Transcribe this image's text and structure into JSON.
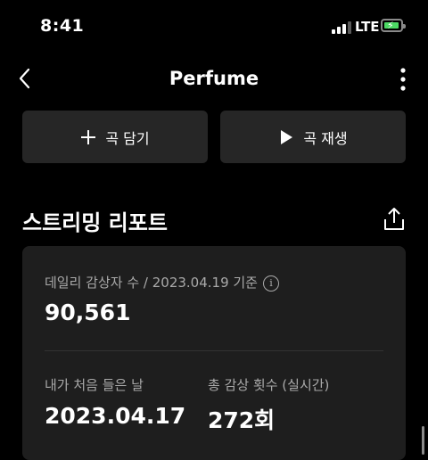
{
  "status_bar": {
    "time": "8:41",
    "network": "LTE",
    "battery_level": 0.7,
    "charging": true
  },
  "header": {
    "title": "Perfume",
    "back_icon": "chevron-left-icon",
    "more_icon": "more-vertical-icon"
  },
  "actions": {
    "add_label": "곡 담기",
    "play_label": "곡 재생"
  },
  "section": {
    "title": "스트리밍 리포트",
    "share_icon": "share-icon"
  },
  "report": {
    "daily_listeners_label": "데일리 감상자 수 / 2023.04.19 기준",
    "daily_listeners_value": "90,561",
    "first_listen_label": "내가 처음 들은 날",
    "first_listen_value": "2023.04.17",
    "total_plays_label": "총 감상 횟수 (실시간)",
    "total_plays_value": "272회"
  },
  "colors": {
    "background": "#000000",
    "card": "#1e1e1e",
    "button": "#262626",
    "secondary_text": "#a9a9a9",
    "battery_green": "#4cd964"
  }
}
